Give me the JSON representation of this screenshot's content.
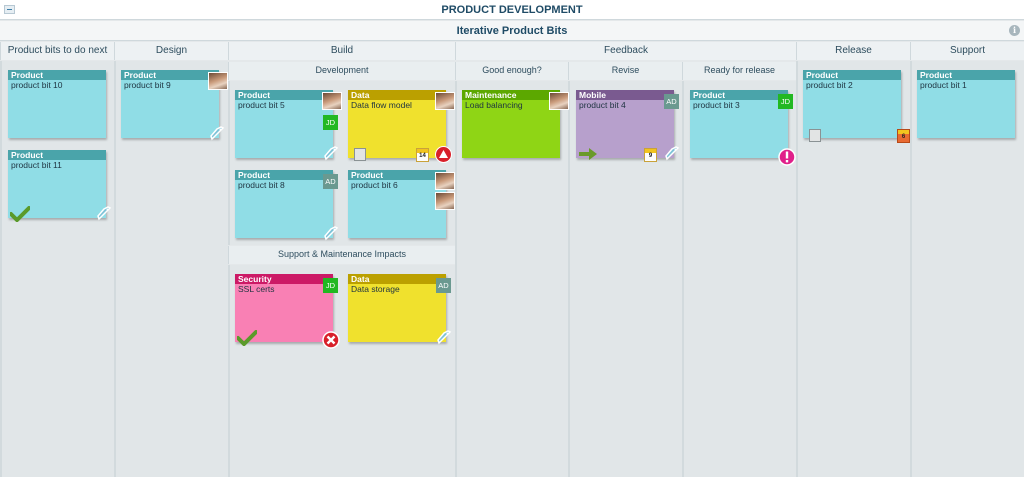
{
  "board": {
    "title": "PRODUCT DEVELOPMENT",
    "subtitle": "Iterative Product Bits",
    "info_icon": "i"
  },
  "columns": {
    "todo": "Product bits to do next",
    "design": "Design",
    "build": "Build",
    "feedback": "Feedback",
    "release": "Release",
    "support": "Support"
  },
  "subcolumns": {
    "development": "Development",
    "good_enough": "Good enough?",
    "revise": "Revise",
    "ready": "Ready for release",
    "support_impacts": "Support & Maintenance Impacts"
  },
  "colors": {
    "product": "#4aa4aa",
    "product_body": "#90dde6",
    "data": "#bba000",
    "data_body": "#f0e12d",
    "maintenance": "#5ca800",
    "maintenance_body": "#8fd515",
    "mobile": "#7a5a90",
    "mobile_body": "#b7a0cc",
    "security": "#cc1a66",
    "security_body": "#f980b4",
    "badge_jd": "#22b822",
    "badge_ad": "#6a9990"
  },
  "cards": {
    "c1": {
      "type": "Product",
      "text": "product bit 10"
    },
    "c2": {
      "type": "Product",
      "text": "product bit 11"
    },
    "c3": {
      "type": "Product",
      "text": "product bit 9"
    },
    "c4": {
      "type": "Product",
      "text": "product bit 5",
      "badge": "JD"
    },
    "c5": {
      "type": "Data",
      "text": "Data flow model",
      "date": "14"
    },
    "c6": {
      "type": "Product",
      "text": "product bit 8",
      "badge": "AD"
    },
    "c7": {
      "type": "Product",
      "text": "product bit 6"
    },
    "c8": {
      "type": "Maintenance",
      "text": "Load balancing"
    },
    "c9": {
      "type": "Mobile",
      "text": "product bit 4",
      "badge": "AD",
      "date": "9"
    },
    "c10": {
      "type": "Product",
      "text": "product bit 3",
      "badge": "JD"
    },
    "c11": {
      "type": "Product",
      "text": "product bit 2",
      "date": "6"
    },
    "c12": {
      "type": "Product",
      "text": "product bit 1"
    },
    "c13": {
      "type": "Security",
      "text": "SSL certs",
      "badge": "JD"
    },
    "c14": {
      "type": "Data",
      "text": "Data storage",
      "badge": "AD"
    }
  }
}
